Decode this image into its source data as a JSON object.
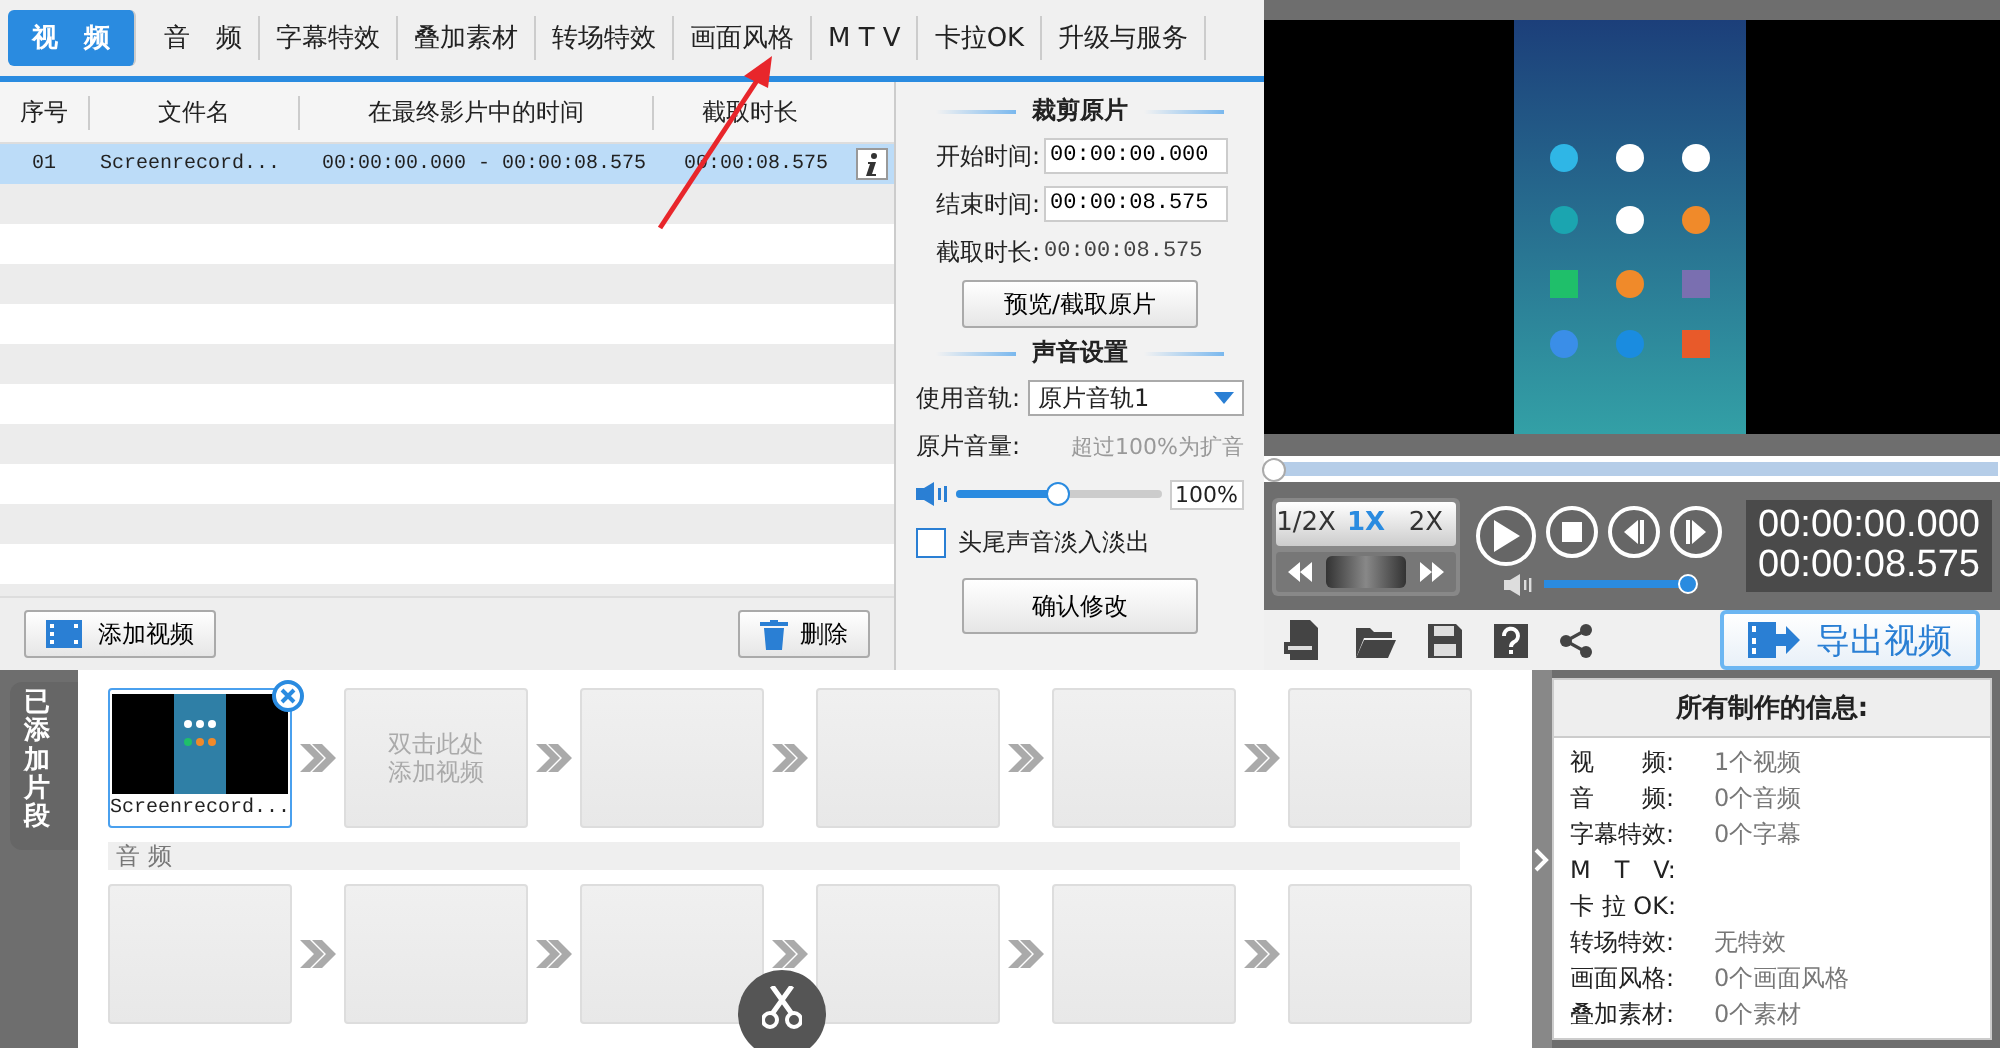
{
  "tabs": [
    {
      "label": "视　频",
      "selected": true
    },
    {
      "label": "音　频",
      "selected": false
    },
    {
      "label": "字幕特效",
      "selected": false
    },
    {
      "label": "叠加素材",
      "selected": false
    },
    {
      "label": "转场特效",
      "selected": false
    },
    {
      "label": "画面风格",
      "selected": false
    },
    {
      "label": "M T V",
      "selected": false
    },
    {
      "label": "卡拉OK",
      "selected": false
    },
    {
      "label": "升级与服务",
      "selected": false
    }
  ],
  "table": {
    "columns": [
      "序号",
      "文件名",
      "在最终影片中的时间",
      "截取时长"
    ],
    "rows": [
      {
        "cells": [
          "01",
          "Screenrecord...",
          "00:00:00.000 - 00:00:08.575",
          "00:00:08.575"
        ],
        "selected": true
      }
    ]
  },
  "list_buttons": {
    "add": "添加视频",
    "delete": "删除"
  },
  "trim": {
    "title": "裁剪原片",
    "start_label": "开始时间:",
    "start_value": "00:00:00.000",
    "end_label": "结束时间:",
    "end_value": "00:00:08.575",
    "duration_label": "截取时长:",
    "duration_value": "00:00:08.575",
    "button": "预览/截取原片"
  },
  "sound": {
    "title": "声音设置",
    "track_label": "使用音轨:",
    "track_value": "原片音轨1",
    "volume_label": "原片音量:",
    "volume_hint": "超过100%为扩音",
    "level": 0.5,
    "volume_value": "100%",
    "fade": {
      "label": "头尾声音淡入淡出",
      "checked": false
    },
    "confirm": "确认修改"
  },
  "player": {
    "seek": {
      "level": 0
    },
    "speeds": [
      {
        "label": "1/2X",
        "selected": false
      },
      {
        "label": "1X",
        "selected": true
      },
      {
        "label": "2X",
        "selected": false
      }
    ],
    "volume": {
      "level": 0.95
    },
    "time_current": "00:00:00.000",
    "time_total": "00:00:08.575",
    "export": "导出视频"
  },
  "clips": {
    "side_tab": "已添加片段",
    "video": [
      {
        "kind": "clip",
        "caption": "Screenrecord..."
      },
      {
        "kind": "empty",
        "placeholder": "双击此处添加视频"
      },
      {
        "kind": "empty"
      },
      {
        "kind": "empty"
      },
      {
        "kind": "empty"
      },
      {
        "kind": "empty"
      }
    ],
    "audio_label": "音 频",
    "audio": [
      {
        "kind": "empty"
      },
      {
        "kind": "empty"
      },
      {
        "kind": "empty"
      },
      {
        "kind": "empty"
      },
      {
        "kind": "empty"
      },
      {
        "kind": "empty"
      }
    ]
  },
  "info": {
    "title": "所有制作的信息:",
    "rows": [
      {
        "label": "视　　频:",
        "value": "1个视频"
      },
      {
        "label": "音　　频:",
        "value": "0个音频"
      },
      {
        "label": "字幕特效:",
        "value": "0个字幕"
      },
      {
        "label": "M　T　V:"
      },
      {
        "label": "卡 拉 OK:"
      },
      {
        "label": "转场特效:",
        "value": "无特效"
      },
      {
        "label": "画面风格:",
        "value": "0个画面风格"
      },
      {
        "label": "叠加素材:",
        "value": "0个素材"
      }
    ]
  }
}
